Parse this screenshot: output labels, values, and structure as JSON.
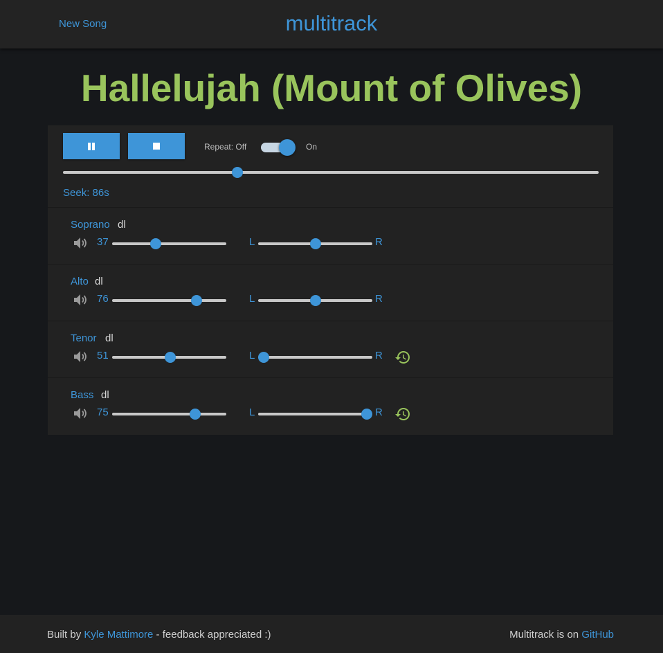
{
  "header": {
    "new_song_label": "New Song",
    "brand": "multitrack"
  },
  "song": {
    "title": "Hallelujah (Mount of Olives)"
  },
  "controls": {
    "pause_icon": "pause-icon",
    "stop_icon": "stop-icon",
    "repeat_off_label": "Repeat: Off",
    "repeat_on_label": "On",
    "repeat_enabled": true,
    "seek_label": "Seek: 86s",
    "seek_fraction": 0.325
  },
  "tracks": [
    {
      "name": "Soprano",
      "dl_label": "dl",
      "volume": 37,
      "volume_fraction": 0.38,
      "pan_left_label": "L",
      "pan_right_label": "R",
      "pan_fraction": 0.5,
      "show_reset": false
    },
    {
      "name": "Alto",
      "dl_label": "dl",
      "volume": 76,
      "volume_fraction": 0.74,
      "pan_left_label": "L",
      "pan_right_label": "R",
      "pan_fraction": 0.5,
      "show_reset": false
    },
    {
      "name": "Tenor",
      "dl_label": "dl",
      "volume": 51,
      "volume_fraction": 0.51,
      "pan_left_label": "L",
      "pan_right_label": "R",
      "pan_fraction": 0.05,
      "show_reset": true
    },
    {
      "name": "Bass",
      "dl_label": "dl",
      "volume": 75,
      "volume_fraction": 0.73,
      "pan_left_label": "L",
      "pan_right_label": "R",
      "pan_fraction": 0.95,
      "show_reset": true
    }
  ],
  "footer": {
    "built_by_prefix": "Built by ",
    "author_link": "Kyle Mattimore",
    "built_by_suffix": " - feedback appreciated :)",
    "github_prefix": "Multitrack is on ",
    "github_link": "GitHub"
  },
  "colors": {
    "accent": "#3e95d8",
    "title": "#99c45c",
    "reset_icon": "#99c45c",
    "background": "#16181b",
    "panel": "#222222"
  }
}
